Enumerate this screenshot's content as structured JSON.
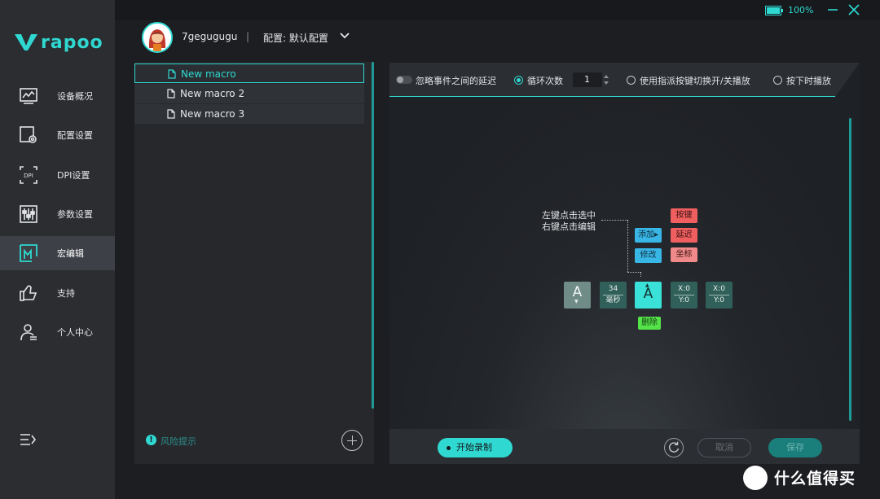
{
  "sidebar": {
    "brand": "rapoo",
    "items": [
      {
        "label": "设备概况",
        "icon": "chart-monitor-icon"
      },
      {
        "label": "配置设置",
        "icon": "config-gear-icon"
      },
      {
        "label": "DPI设置",
        "icon": "dpi-icon"
      },
      {
        "label": "参数设置",
        "icon": "sliders-icon"
      },
      {
        "label": "宏编辑",
        "icon": "macro-icon",
        "active": true
      },
      {
        "label": "支持",
        "icon": "thumbs-up-icon"
      },
      {
        "label": "个人中心",
        "icon": "user-profile-icon"
      }
    ]
  },
  "topbar": {
    "battery": "100%"
  },
  "profile": {
    "username": "7gegugugu",
    "separator": "|",
    "config": "配置: 默认配置"
  },
  "macros": {
    "items": [
      "New macro",
      "New macro 2",
      "New macro 3"
    ],
    "risk_label": "风险提示"
  },
  "options": {
    "ignore_delay": "忽略事件之间的延迟",
    "loop_count_label": "循环次数",
    "loop_count_value": "1",
    "assign_toggle": "使用指派按键切换开/关播放",
    "hold_play": "按下时播放"
  },
  "diagram": {
    "hint_line1": "左键点击选中",
    "hint_line2": "右键点击编辑",
    "add_label": "添加▸",
    "modify_label": "修改",
    "key_label": "按键",
    "delay_label": "延迟",
    "coord_label": "坐标",
    "delete_label": "删除",
    "tile_key1": "A",
    "tile_delay_value": "34",
    "tile_delay_unit": "毫秒",
    "tile_key2": "A",
    "tile_coord1_x": "X:0",
    "tile_coord1_y": "Y:0",
    "tile_coord2_x": "X:0",
    "tile_coord2_y": "Y:0"
  },
  "footer": {
    "record": "开始录制",
    "cancel": "取消",
    "save": "保存"
  },
  "watermark": "什么值得买",
  "colors": {
    "accent": "#2fd9d2",
    "sidebar_bg": "#2b2d31",
    "panel_bg": "#26282c",
    "tag_blue": "#38b6e6",
    "tag_red": "#ef5f5f",
    "tag_green": "#55e34a"
  }
}
